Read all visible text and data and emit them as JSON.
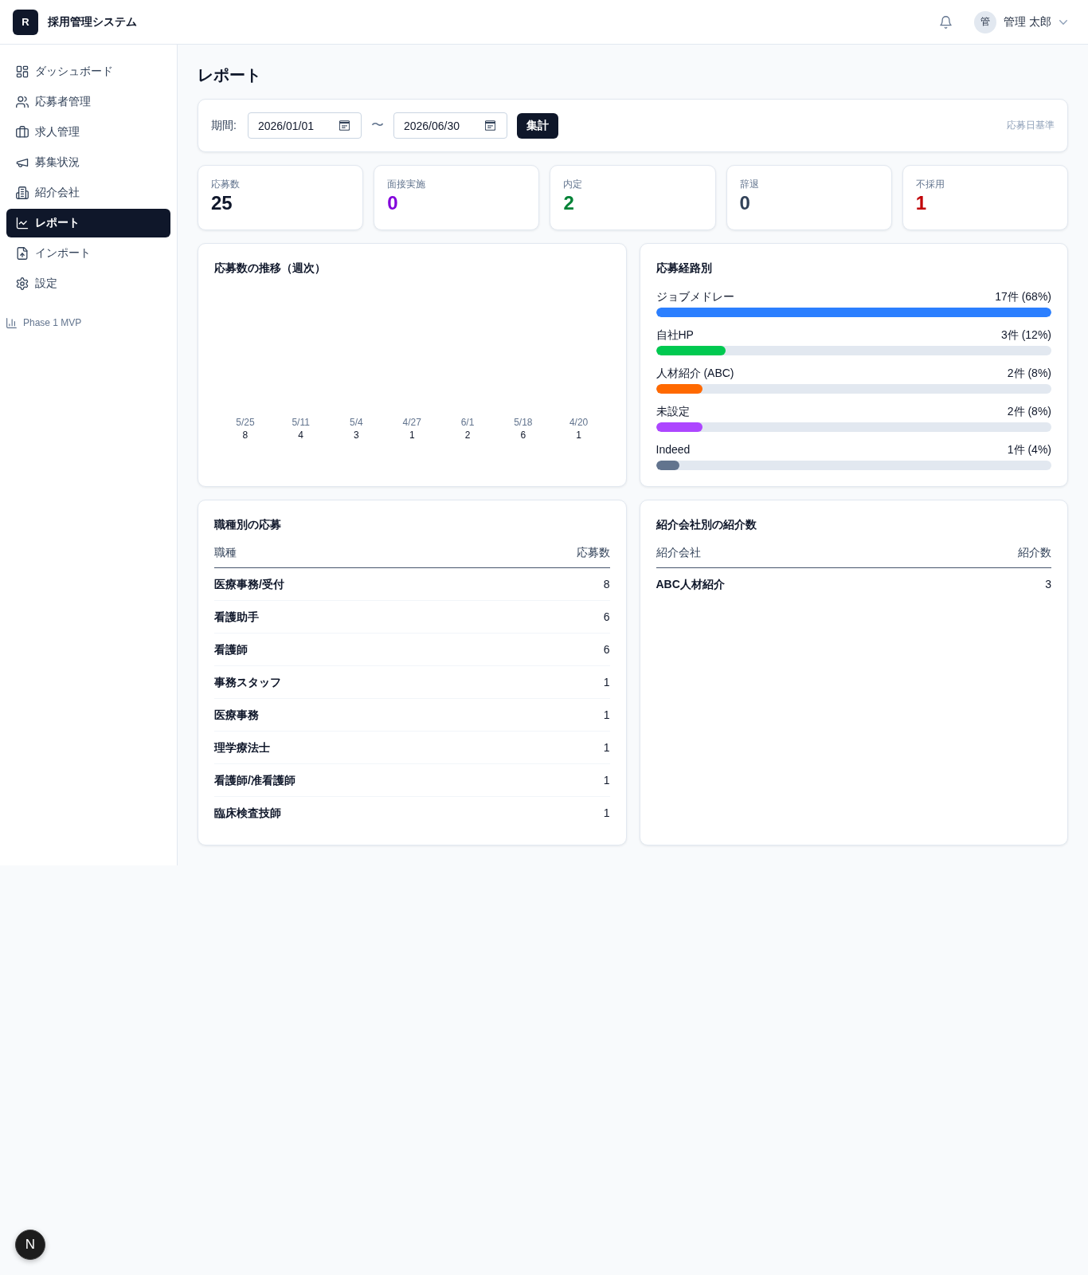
{
  "header": {
    "logo_letter": "R",
    "app_title": "採用管理システム",
    "user_initial": "管",
    "user_name": "管理 太郎"
  },
  "sidebar": {
    "items": [
      {
        "label": "ダッシュボード",
        "selected": false
      },
      {
        "label": "応募者管理",
        "selected": false
      },
      {
        "label": "求人管理",
        "selected": false
      },
      {
        "label": "募集状況",
        "selected": false
      },
      {
        "label": "紹介会社",
        "selected": false
      },
      {
        "label": "レポート",
        "selected": true
      },
      {
        "label": "インポート",
        "selected": false
      },
      {
        "label": "設定",
        "selected": false
      }
    ],
    "footer": "Phase 1 MVP"
  },
  "page_title": "レポート",
  "filter": {
    "label": "期間:",
    "start_date": "2026/01/01",
    "separator": "〜",
    "end_date": "2026/06/30",
    "button": "集計",
    "note": "応募日基準"
  },
  "stats": [
    {
      "label": "応募数",
      "value": "25",
      "color": "#0f172b"
    },
    {
      "label": "面接実施",
      "value": "0",
      "color": "#8200db"
    },
    {
      "label": "内定",
      "value": "2",
      "color": "#008236"
    },
    {
      "label": "辞退",
      "value": "0",
      "color": "#314158"
    },
    {
      "label": "不採用",
      "value": "1",
      "color": "#c10007"
    }
  ],
  "weekly_trend": {
    "title": "応募数の推移（週次）",
    "weeks": [
      {
        "week": "5/25",
        "count": "8"
      },
      {
        "week": "5/11",
        "count": "4"
      },
      {
        "week": "5/4",
        "count": "3"
      },
      {
        "week": "4/27",
        "count": "1"
      },
      {
        "week": "6/1",
        "count": "2"
      },
      {
        "week": "5/18",
        "count": "6"
      },
      {
        "week": "4/20",
        "count": "1"
      }
    ]
  },
  "sources": {
    "title": "応募経路別",
    "items": [
      {
        "name": "ジョブメドレー",
        "reading": "17件 (68%)",
        "level": 1,
        "color": "#2b7fff"
      },
      {
        "name": "自社HP",
        "reading": "3件 (12%)",
        "level": 0.176,
        "color": "#00c950"
      },
      {
        "name": "人材紹介 (ABC)",
        "reading": "2件 (8%)",
        "level": 0.118,
        "color": "#ff6900"
      },
      {
        "name": "未設定",
        "reading": "2件 (8%)",
        "level": 0.118,
        "color": "#ad46ff"
      },
      {
        "name": "Indeed",
        "reading": "1件 (4%)",
        "level": 0.059,
        "color": "#62748e"
      }
    ]
  },
  "job_types": {
    "title": "職種別の応募",
    "columns": [
      "職種",
      "応募数"
    ],
    "rows": [
      {
        "name": "医療事務/受付",
        "count": "8"
      },
      {
        "name": "看護助手",
        "count": "6"
      },
      {
        "name": "看護師",
        "count": "6"
      },
      {
        "name": "事務スタッフ",
        "count": "1"
      },
      {
        "name": "医療事務",
        "count": "1"
      },
      {
        "name": "理学療法士",
        "count": "1"
      },
      {
        "name": "看護師/准看護師",
        "count": "1"
      },
      {
        "name": "臨床検査技師",
        "count": "1"
      }
    ]
  },
  "agencies": {
    "title": "紹介会社別の紹介数",
    "columns": [
      "紹介会社",
      "紹介数"
    ],
    "rows": [
      {
        "name": "ABC人材紹介",
        "count": "3"
      }
    ]
  },
  "dev_badge": {
    "label": "N"
  }
}
